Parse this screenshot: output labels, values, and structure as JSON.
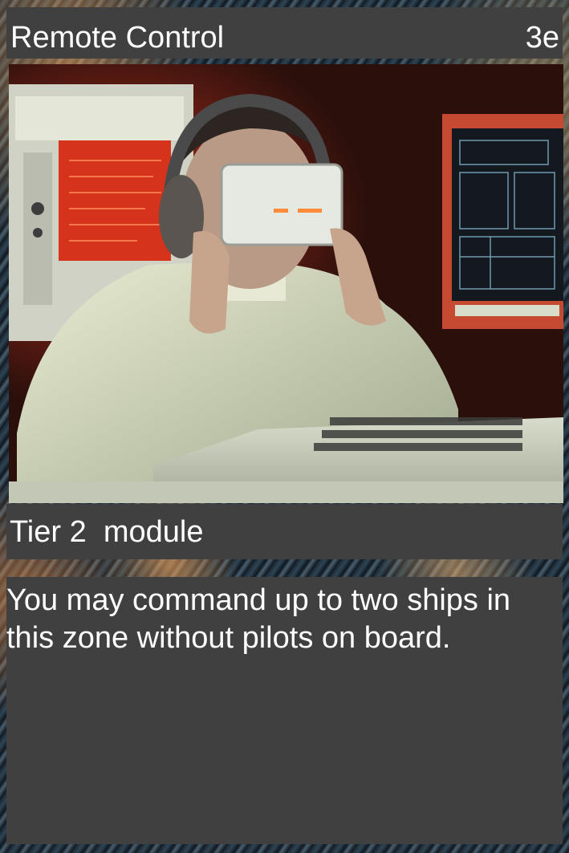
{
  "card": {
    "title": "Remote Control",
    "cost": "3e",
    "type_line": "Tier 2  module",
    "rules_text": "You may command up to two ships in this zone without pilots on board."
  },
  "artwork": {
    "subject": "illustration-operator-vr-headset"
  },
  "colors": {
    "bar_background": "#404040",
    "text": "#ffffff"
  }
}
